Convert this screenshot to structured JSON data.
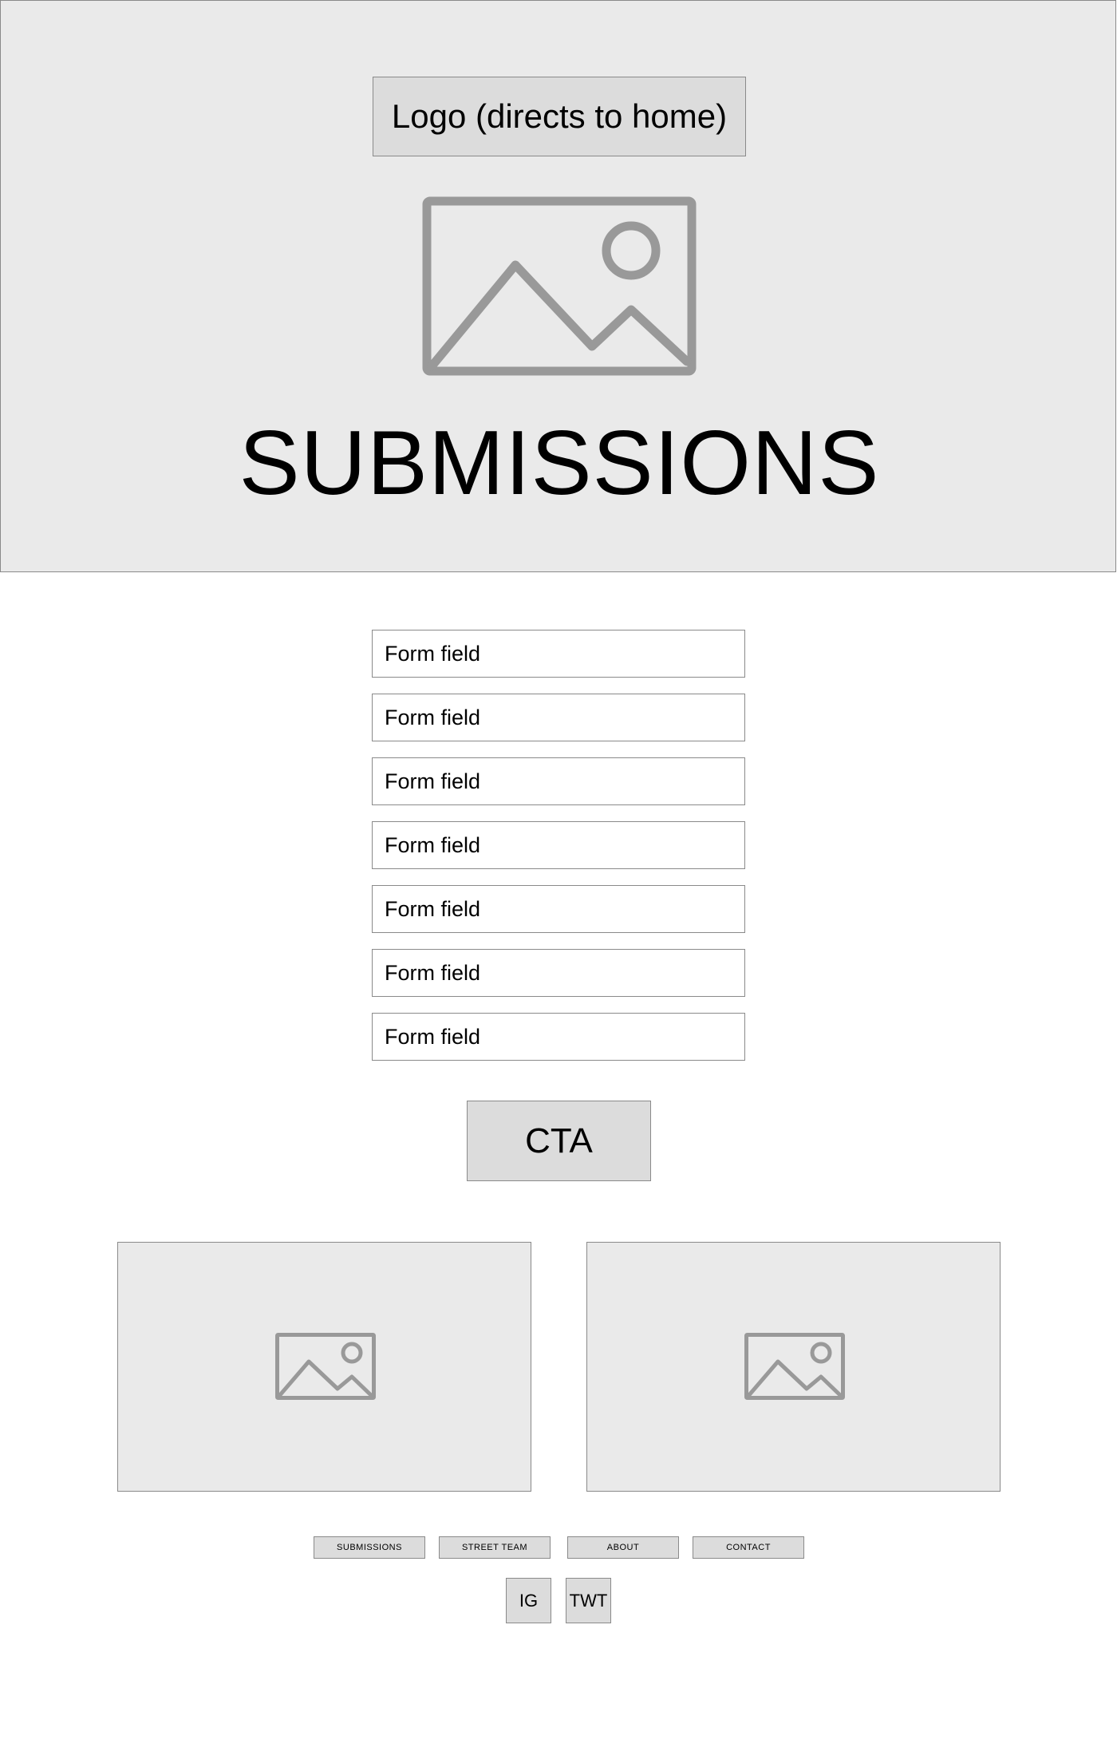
{
  "header": {
    "logo_label": "Logo (directs to home)",
    "hero_image_icon": "image-placeholder-icon",
    "title": "SUBMISSIONS"
  },
  "form": {
    "fields": [
      {
        "placeholder": "Form field"
      },
      {
        "placeholder": "Form field"
      },
      {
        "placeholder": "Form field"
      },
      {
        "placeholder": "Form field"
      },
      {
        "placeholder": "Form field"
      },
      {
        "placeholder": "Form field"
      },
      {
        "placeholder": "Form field"
      }
    ],
    "cta_label": "CTA"
  },
  "gallery": {
    "tiles": [
      {
        "icon": "image-placeholder-icon"
      },
      {
        "icon": "image-placeholder-icon"
      }
    ]
  },
  "footer": {
    "nav": [
      {
        "label": "SUBMISSIONS"
      },
      {
        "label": "STREET TEAM"
      },
      {
        "label": "ABOUT"
      },
      {
        "label": "CONTACT"
      }
    ],
    "social": [
      {
        "label": "IG"
      },
      {
        "label": "TWT"
      }
    ]
  },
  "colors": {
    "hero_background": "#eaeaea",
    "button_background": "#dcdcdc",
    "border": "#8a8a8a",
    "icon_stroke": "#999999"
  }
}
